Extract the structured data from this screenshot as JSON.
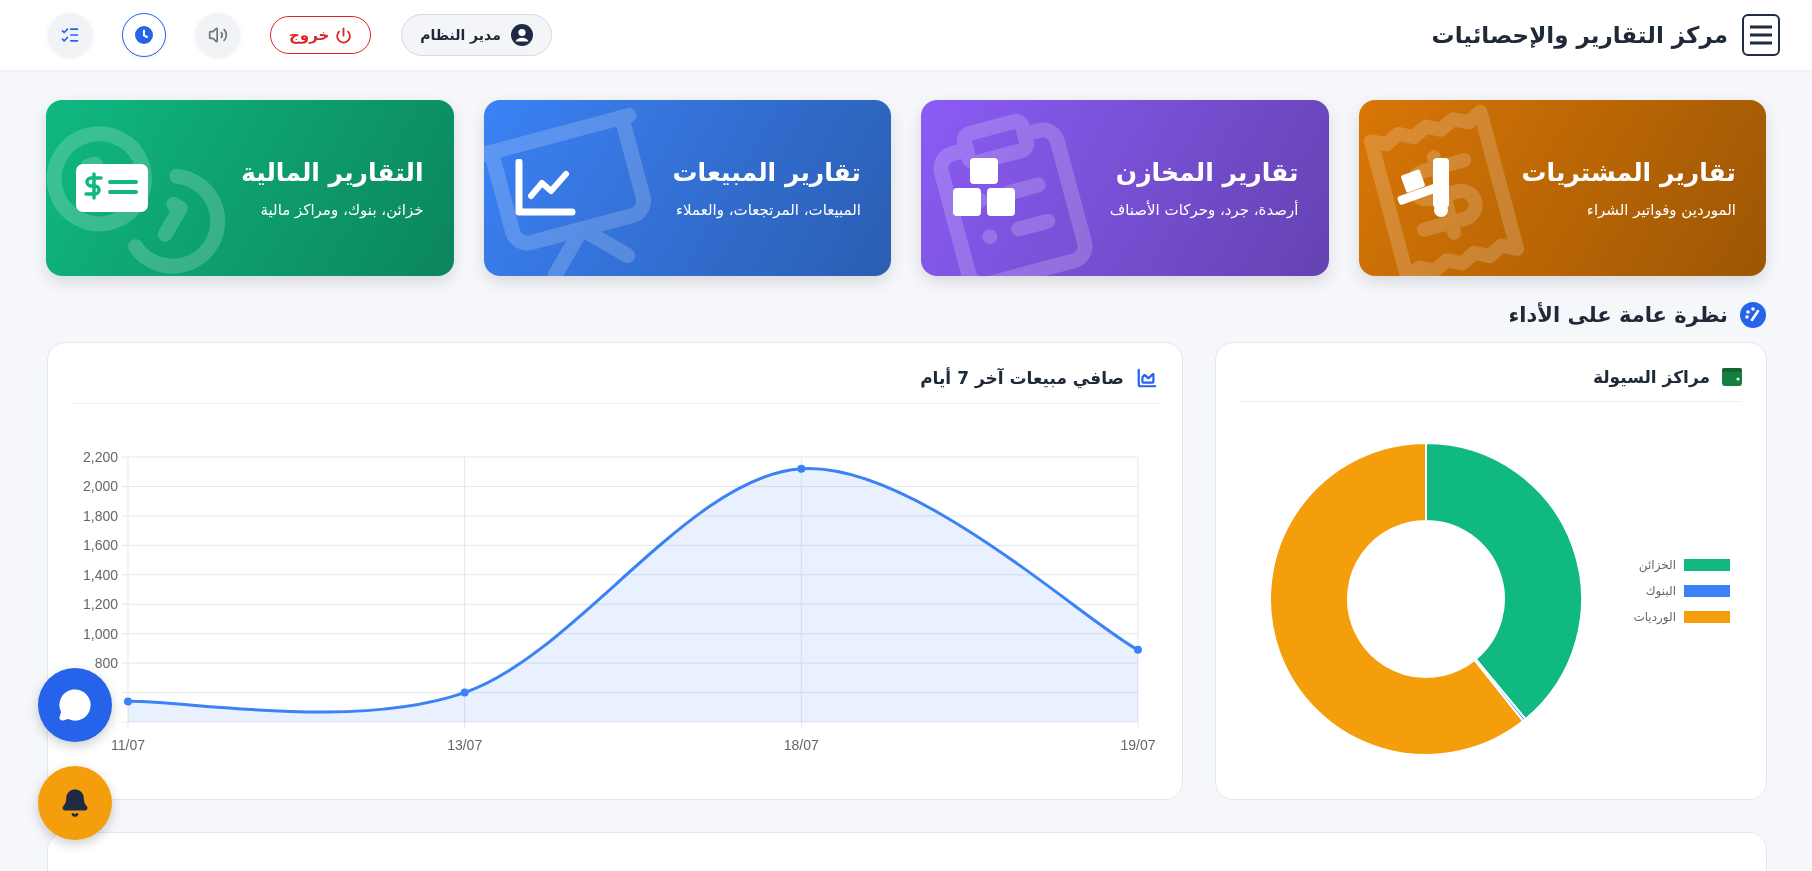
{
  "header": {
    "title": "مركز التقارير والإحصائيات",
    "user": "مدير النظام",
    "logout": "خروج"
  },
  "report_cards": [
    {
      "kind": "dolly",
      "title": "تقارير المشتريات",
      "subtitle": "الموردين وفواتير الشراء",
      "color": "#d97706"
    },
    {
      "kind": "boxes",
      "title": "تقارير المخازن",
      "subtitle": "أرصدة، جرد، وحركات الأصناف",
      "color": "#8b5cf6"
    },
    {
      "kind": "chart",
      "title": "تقارير المبيعات",
      "subtitle": "المبيعات، المرتجعات، والعملاء",
      "color": "#3b82f6"
    },
    {
      "kind": "cash",
      "title": "التقارير المالية",
      "subtitle": "خزائن، بنوك، ومراكز مالية",
      "color": "#10b981"
    }
  ],
  "overview": {
    "title": "نظرة عامة على الأداء",
    "liquidity": {
      "title": "مراكز السيولة",
      "chart_data": {
        "type": "donut",
        "categories": [
          "الخزائن",
          "البنوك",
          "الورديات"
        ],
        "values": [
          39,
          0.3,
          60.7
        ],
        "colors": [
          "#10b981",
          "#3b82f6",
          "#f59e0b"
        ]
      }
    },
    "sales": {
      "title": "صافي مبيعات آخر 7 أيام",
      "chart_data": {
        "type": "area",
        "categories": [
          "11/07",
          "13/07",
          "18/07",
          "19/07"
        ],
        "series": [
          {
            "color": "#3b82f6",
            "values": [
              540,
              600,
              2120,
              890
            ]
          }
        ],
        "grid": true,
        "ylim": [
          400,
          2200
        ],
        "yticks": [
          {
            "value": 800,
            "label": "800"
          },
          {
            "value": 1000,
            "label": "1,000"
          },
          {
            "value": 1200,
            "label": "1,200"
          },
          {
            "value": 1400,
            "label": "1,400"
          },
          {
            "value": 1600,
            "label": "1,600"
          },
          {
            "value": 1800,
            "label": "1,800"
          },
          {
            "value": 2000,
            "label": "2,000"
          },
          {
            "value": 2200,
            "label": "2,200"
          }
        ]
      }
    }
  }
}
